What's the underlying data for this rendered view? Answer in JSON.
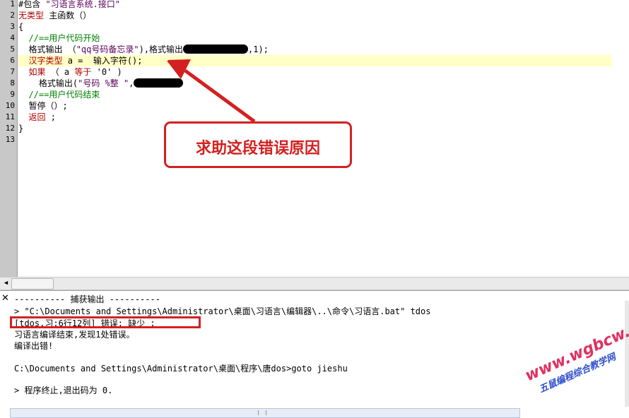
{
  "editor": {
    "line_numbers": [
      "1",
      "2",
      "3",
      "4",
      "5",
      "6",
      "7",
      "8",
      "9",
      "10",
      "11",
      "12",
      "13"
    ],
    "lines": [
      {
        "parts": [
          {
            "t": "#包含 ",
            "c": ""
          },
          {
            "t": "\"习语言系统.接口\"",
            "c": "st"
          }
        ]
      },
      {
        "parts": [
          {
            "t": "无类型",
            "c": "kw"
          },
          {
            "t": " 主函数（）",
            "c": ""
          }
        ]
      },
      {
        "parts": [
          {
            "t": "{",
            "c": ""
          }
        ]
      },
      {
        "parts": [
          {
            "t": "  //==用户代码开始",
            "c": "cm"
          }
        ]
      },
      {
        "parts": [
          {
            "t": "  格式输出 （",
            "c": ""
          },
          {
            "t": "\"qq号码备忘录\"",
            "c": "st"
          },
          {
            "t": "),格式输出",
            "c": ""
          },
          {
            "t": "MASK",
            "c": "mask"
          },
          {
            "t": ",1);",
            "c": ""
          }
        ]
      },
      {
        "parts": [
          {
            "t": "  ",
            "c": ""
          },
          {
            "t": "汉字类型",
            "c": "kw"
          },
          {
            "t": " a =  输入字符();",
            "c": ""
          }
        ]
      },
      {
        "parts": [
          {
            "t": "  ",
            "c": ""
          },
          {
            "t": "如果",
            "c": "kw"
          },
          {
            "t": " （ a ",
            "c": ""
          },
          {
            "t": "等于",
            "c": "kw"
          },
          {
            "t": " '0' )",
            "c": ""
          }
        ]
      },
      {
        "parts": [
          {
            "t": "    格式输出(",
            "c": ""
          },
          {
            "t": "\"号码 %整 \"",
            "c": "st"
          },
          {
            "t": ",",
            "c": ""
          },
          {
            "t": "MASK",
            "c": "mask"
          }
        ]
      },
      {
        "parts": [
          {
            "t": "  //==用户代码结束",
            "c": "cm"
          }
        ]
      },
      {
        "parts": [
          {
            "t": "  暂停（）;",
            "c": ""
          }
        ]
      },
      {
        "parts": [
          {
            "t": "  ",
            "c": ""
          },
          {
            "t": "返回",
            "c": "kw"
          },
          {
            "t": " ;",
            "c": ""
          }
        ]
      },
      {
        "parts": [
          {
            "t": "}",
            "c": ""
          }
        ]
      },
      {
        "parts": [
          {
            "t": "",
            "c": ""
          }
        ]
      }
    ],
    "highlighted_line": 6
  },
  "annotation": {
    "callout_text": "求助这段错误原因",
    "accent_color": "#d42020"
  },
  "output": {
    "header": "---------- 捕获输出 ----------",
    "command": "> \"C:\\Documents and Settings\\Administrator\\桌面\\习语言\\编辑器\\..\\命令\\习语言.bat\" tdos",
    "error_line": "[tdos.习:6行12列] 错误: 缺少 ;",
    "summary": "习语言编译结束,发现1处错误。",
    "compile_failed": "编译出错!",
    "blank": "",
    "goto_line": "C:\\Documents and Settings\\Administrator\\桌面\\程序\\唐dos>goto jieshu",
    "exit_line": "> 程序终止,退出码为 0."
  },
  "watermark": {
    "url": "www.wgbcw.com",
    "sub": "五鼠编程综合教学网"
  },
  "icons": {
    "close": "close-icon",
    "scroll_left": "scroll-left-arrow-icon"
  }
}
